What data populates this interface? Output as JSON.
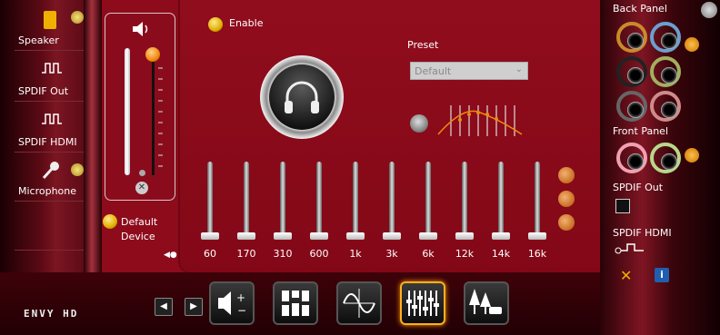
{
  "left_devices": [
    {
      "label": "Speaker"
    },
    {
      "label": "SPDIF Out"
    },
    {
      "label": "SPDIF HDMI"
    },
    {
      "label": "Microphone"
    }
  ],
  "volume": {
    "level": 0.95
  },
  "default_device": {
    "label": "Default Device"
  },
  "enable": {
    "label": "Enable"
  },
  "preset": {
    "label": "Preset",
    "value": "Default"
  },
  "eq": {
    "bands": [
      "60",
      "170",
      "310",
      "600",
      "1k",
      "3k",
      "6k",
      "12k",
      "14k",
      "16k"
    ],
    "levels": [
      0,
      0,
      0,
      0,
      0,
      0,
      0,
      0,
      0,
      0
    ]
  },
  "logo_text": "ENVY HD",
  "right_panel": {
    "back_panel": "Back Panel",
    "front_panel": "Front Panel",
    "spdif_out": "SPDIF Out",
    "spdif_hdmi": "SPDIF HDMI"
  },
  "colors": {
    "accent": "#f08a10",
    "main_red": "#8d0b1b"
  }
}
